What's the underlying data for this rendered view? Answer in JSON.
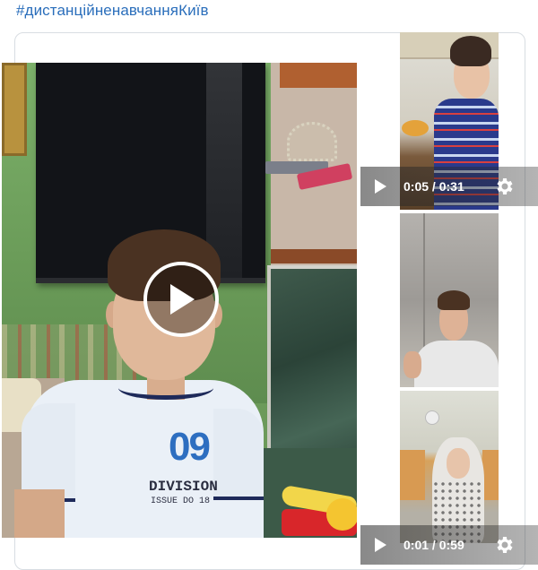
{
  "hashtag": "#дистанційненавчанняКиїв",
  "main_video": {
    "shirt_number": "09",
    "shirt_text_1": "DIVISION",
    "shirt_text_2": "ISSUE DO 18"
  },
  "video_controls": [
    {
      "current": "0:05",
      "separator": " / ",
      "duration": "0:31"
    },
    {
      "current": "0:01",
      "separator": " / ",
      "duration": "0:59"
    }
  ],
  "icons": {
    "main_play": "play-icon",
    "small_play": "play-icon",
    "settings": "gear-icon"
  },
  "colors": {
    "hashtag": "#2a6ebb",
    "card_border": "#d8dde2",
    "control_text": "#ffffff"
  }
}
